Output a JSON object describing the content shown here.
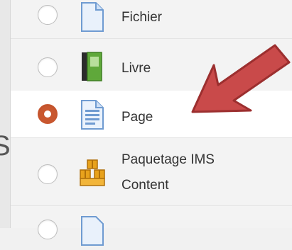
{
  "activities": [
    {
      "label": "Fichier",
      "icon": "file-icon",
      "selected": false
    },
    {
      "label": "Livre",
      "icon": "book-icon",
      "selected": false
    },
    {
      "label": "Page",
      "icon": "page-icon",
      "selected": true
    },
    {
      "label": "Paquetage IMS Content",
      "icon": "ims-package-icon",
      "selected": false
    },
    {
      "label": "",
      "icon": "file-icon",
      "selected": false
    }
  ],
  "colors": {
    "accent_radio": "#c9572f",
    "arrow": "#c94a4a"
  }
}
